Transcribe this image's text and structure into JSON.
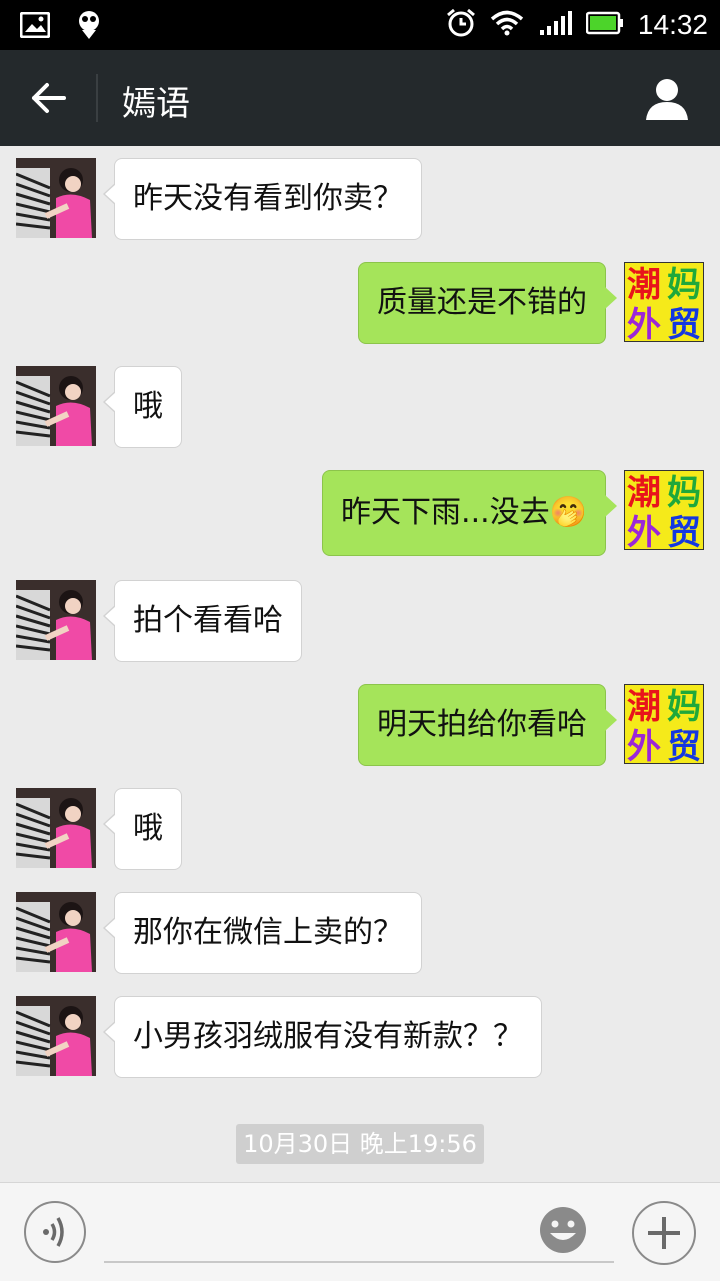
{
  "status_bar": {
    "time": "14:32"
  },
  "header": {
    "title": "嫣语"
  },
  "messages": [
    {
      "side": "in",
      "text": "昨天没有看到你卖？"
    },
    {
      "side": "out",
      "text": "质量还是不错的"
    },
    {
      "side": "in",
      "text": "哦"
    },
    {
      "side": "out",
      "text": "昨天下雨...没去",
      "emoji": "🤭"
    },
    {
      "side": "in",
      "text": "拍个看看哈"
    },
    {
      "side": "out",
      "text": "明天拍给你看哈"
    },
    {
      "side": "in",
      "text": "哦"
    },
    {
      "side": "in",
      "text": "那你在微信上卖的？"
    },
    {
      "side": "in",
      "text": "小男孩羽绒服有没有新款？？"
    }
  ],
  "my_avatar": {
    "chars": [
      "潮",
      "妈",
      "外",
      "贸"
    ],
    "colors": [
      "#e8141b",
      "#1fa83b",
      "#9b27d8",
      "#1437e0"
    ],
    "bg": "#f5ea1a"
  },
  "timestamp": "10月30日 晚上19:56",
  "input": {
    "placeholder": "",
    "value": ""
  }
}
